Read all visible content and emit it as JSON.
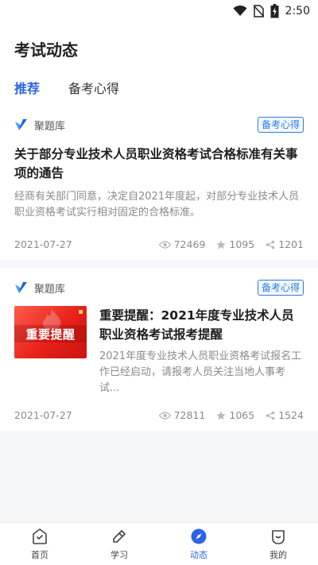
{
  "status": {
    "time": "2:50"
  },
  "header": {
    "title": "考试动态"
  },
  "tabs": [
    {
      "label": "推荐",
      "active": true
    },
    {
      "label": "备考心得",
      "active": false
    }
  ],
  "articles": [
    {
      "source": "聚题库",
      "tag": "备考心得",
      "title": "关于部分专业技术人员职业资格考试合格标准有关事项的通告",
      "desc": "经商有关部门同意，决定自2021年度起，对部分专业技术人员职业资格考试实行相对固定的合格标准。",
      "date": "2021-07-27",
      "views": "72469",
      "favorites": "1095",
      "shares": "1201"
    },
    {
      "source": "聚题库",
      "tag": "备考心得",
      "thumb_text": "重要提醒",
      "title": "重要提醒：2021年度专业技术人员职业资格考试报考提醒",
      "desc": "2021年度专业技术人员职业资格考试报名工作已经启动，请报考人员关注当地人事考试...",
      "date": "2021-07-27",
      "views": "72811",
      "favorites": "1065",
      "shares": "1524"
    }
  ],
  "tabbar": [
    {
      "label": "首页",
      "icon": "home-check-icon"
    },
    {
      "label": "学习",
      "icon": "pencil-icon"
    },
    {
      "label": "动态",
      "icon": "compass-icon",
      "active": true
    },
    {
      "label": "我的",
      "icon": "smile-icon"
    }
  ],
  "colors": {
    "accent": "#2c63e8",
    "tag": "#2c7be5",
    "thumb": "#e8211a"
  }
}
